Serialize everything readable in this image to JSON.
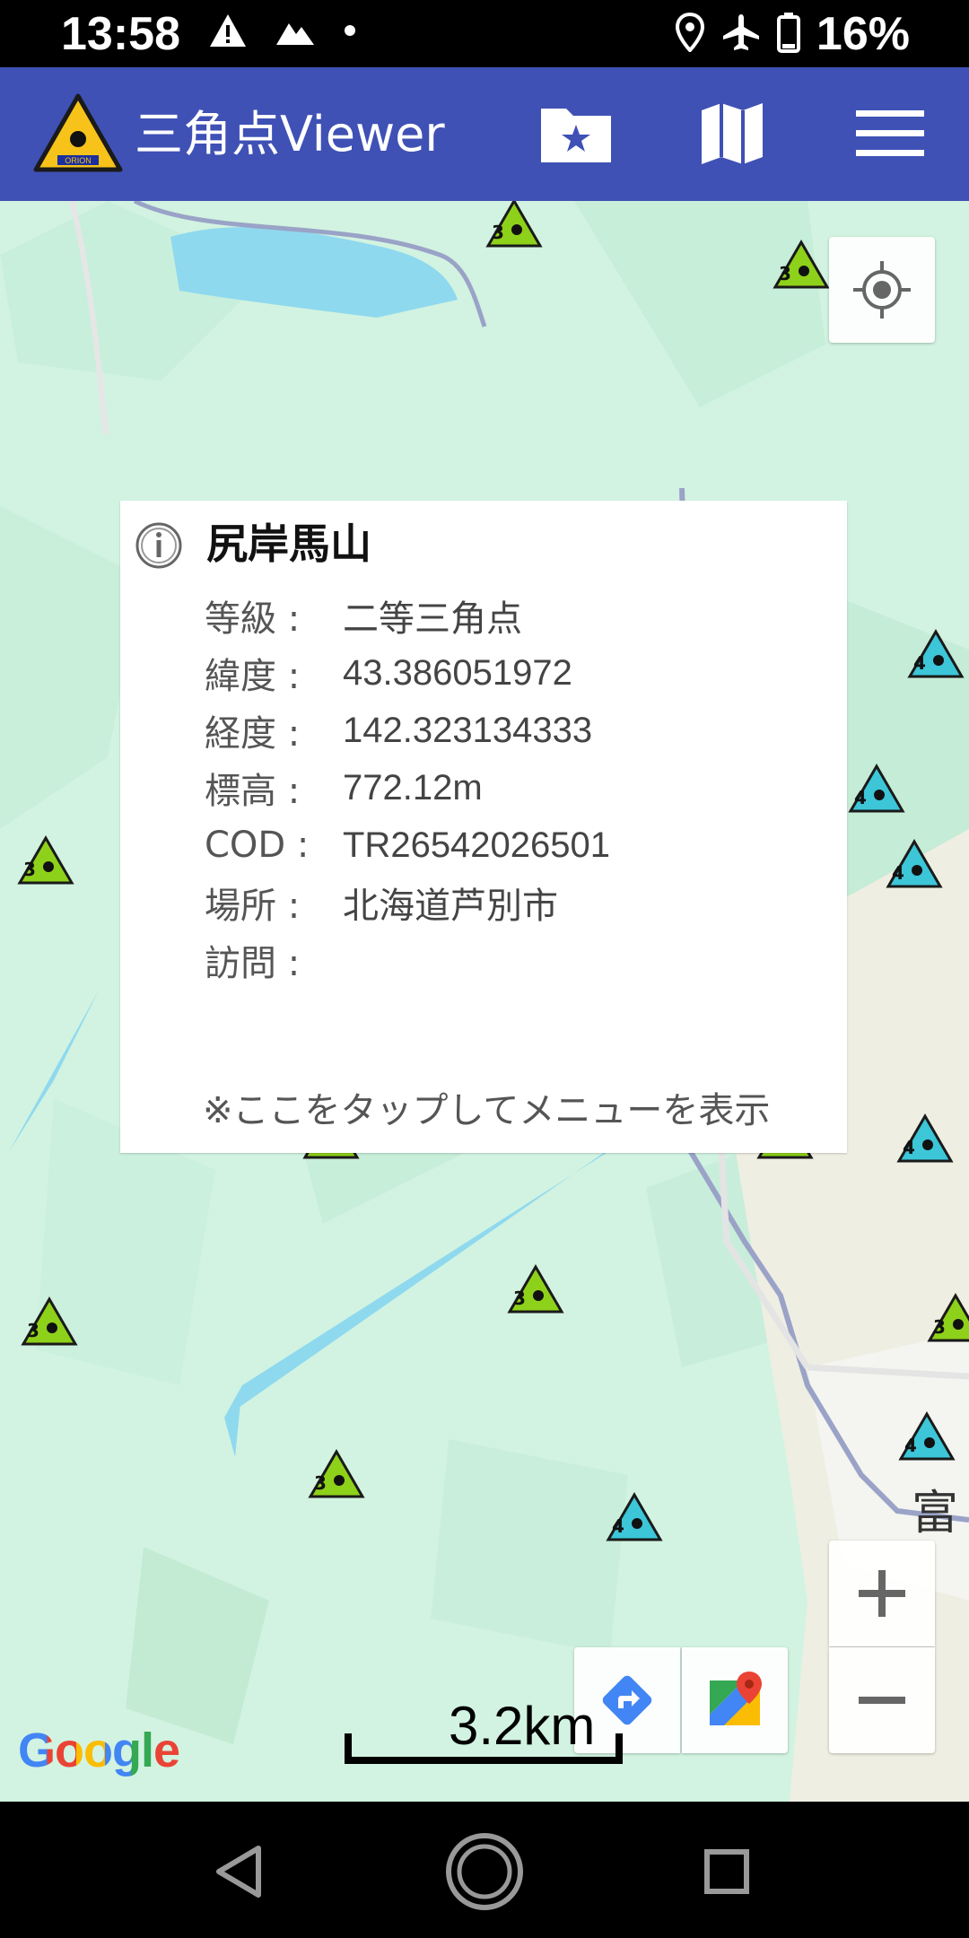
{
  "status_bar": {
    "time": "13:58",
    "battery": "16%",
    "icons": [
      "warning-icon",
      "mountain-icon",
      "dot-icon",
      "location-icon",
      "airplane-icon",
      "battery-icon"
    ]
  },
  "app_bar": {
    "title": "三角点Viewer",
    "logo_text": "ORION",
    "actions": [
      "folder-star-icon",
      "map-icon",
      "menu-icon"
    ],
    "color": "#3f51b5"
  },
  "info_window": {
    "title": "尻岸馬山",
    "rows": [
      {
        "label": "等級 :",
        "value": "二等三角点"
      },
      {
        "label": "緯度 :",
        "value": "43.386051972"
      },
      {
        "label": "経度 :",
        "value": "142.323134333"
      },
      {
        "label": "標高 :",
        "value": "772.12m"
      },
      {
        "label": "COD :",
        "value": "TR26542026501"
      },
      {
        "label": "場所 :",
        "value": "北海道芦別市"
      },
      {
        "label": "訪問 :",
        "value": ""
      }
    ],
    "hint": "※ここをタップしてメニューを表示"
  },
  "map": {
    "scale_label": "3.2km",
    "place_label": "富",
    "google_logo": "Google",
    "markers": [
      {
        "grade": "3",
        "color": "green"
      },
      {
        "grade": "3",
        "color": "green"
      },
      {
        "grade": "4",
        "color": "cyan"
      },
      {
        "grade": "4",
        "color": "cyan"
      },
      {
        "grade": "3",
        "color": "green"
      },
      {
        "grade": "4",
        "color": "cyan"
      },
      {
        "grade": "4",
        "color": "cyan"
      },
      {
        "grade": "4",
        "color": "cyan"
      },
      {
        "grade": "3",
        "color": "green"
      },
      {
        "grade": "4",
        "color": "cyan"
      },
      {
        "grade": "3",
        "color": "green"
      },
      {
        "grade": "3",
        "color": "green"
      },
      {
        "grade": "4",
        "color": "cyan"
      },
      {
        "grade": "3",
        "color": "green"
      },
      {
        "grade": "3",
        "color": "green"
      },
      {
        "grade": "3",
        "color": "green"
      },
      {
        "grade": "4",
        "color": "cyan"
      },
      {
        "grade": "4",
        "color": "cyan"
      },
      {
        "grade": "3",
        "color": "green"
      },
      {
        "grade": "4",
        "color": "cyan"
      }
    ],
    "colors": {
      "green": "#8ed11a",
      "cyan": "#3cc6d8",
      "water": "#8fd9ef",
      "road": "#9aa3c7"
    }
  },
  "controls": {
    "locate": "my-location-icon",
    "zoom_in": "+",
    "zoom_out": "−",
    "directions": "directions-icon",
    "google_maps": "google-maps-icon"
  },
  "nav_bar": {
    "buttons": [
      "back-icon",
      "home-icon",
      "recents-icon"
    ]
  }
}
